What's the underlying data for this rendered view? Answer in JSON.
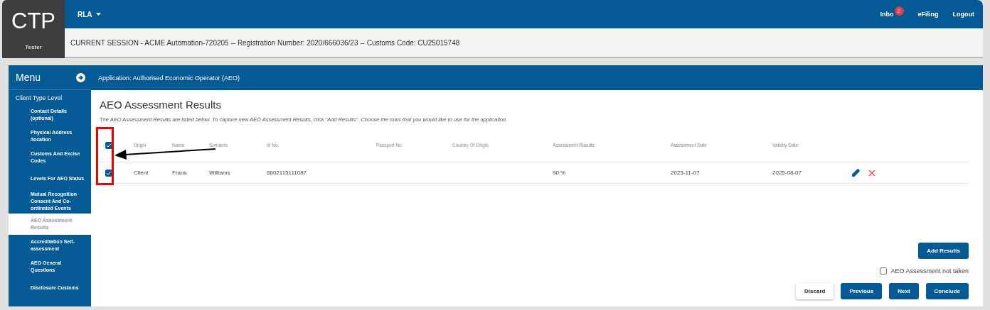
{
  "logo": {
    "title": "CTP",
    "user": "Tester"
  },
  "top_nav": {
    "dropdown": "RLA",
    "links": [
      {
        "label": "Inbo",
        "badge": "2"
      },
      {
        "label": "eFiling"
      },
      {
        "label": "Logout"
      }
    ]
  },
  "session_bar": "CURRENT SESSION - ACME Automation-720205 -- Registration Number: 2020/666036/23 -- Customs Code: CU25015748",
  "sidebar": {
    "title": "Menu",
    "section": "Client Type Level",
    "items": [
      {
        "label": "Contact Details (optional)",
        "selected": false
      },
      {
        "label": "Physical Address /location",
        "selected": false
      },
      {
        "label": "Customs And Excise Codes",
        "selected": false
      },
      {
        "label": "Levels For AEO Status",
        "selected": false
      },
      {
        "label": "Mutual Recognition Consent And Co-ordinated Events",
        "selected": false
      },
      {
        "label": "AEO Assessment Results",
        "selected": true
      },
      {
        "label": "Accreditation Self-assessment",
        "selected": false
      },
      {
        "label": "AEO General Questions",
        "selected": false
      },
      {
        "label": "Disclosure Customs",
        "selected": false
      }
    ]
  },
  "application_header": "Application: Authorised Economic Operator (AEO)",
  "page_title": "AEO Assessment Results",
  "instructions": "The AEO Assessment Results are listed below. To capture new AEO Assessment Results, click \"Add Results\". Choose the rows that you would like to use for the application.",
  "table": {
    "select_all": true,
    "columns": [
      "Origin",
      "Name",
      "Surname",
      "Id No.",
      "Passport No.",
      "Country Of Origin",
      "Assessment Results",
      "Assessment Date",
      "Validity Date"
    ],
    "rows": [
      {
        "checked": true,
        "cells": [
          "Client",
          "Frans",
          "Williams",
          "6602115111087",
          "",
          "",
          "90 %",
          "2023-11-07",
          "2025-08-07"
        ]
      }
    ]
  },
  "add_button": "Add Results",
  "not_taken": {
    "label": "AEO Assessment not taken",
    "checked": false
  },
  "buttons": [
    {
      "label": "Discard",
      "kind": "secondary"
    },
    {
      "label": "Previous",
      "kind": "primary"
    },
    {
      "label": "Next",
      "kind": "primary"
    },
    {
      "label": "Conclude",
      "kind": "primary"
    }
  ]
}
